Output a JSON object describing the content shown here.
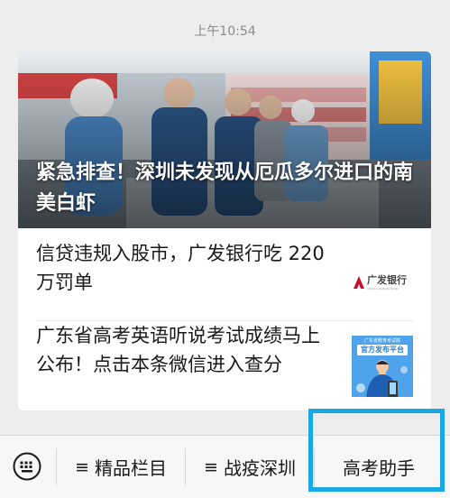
{
  "chat": {
    "timestamp": "上午10:54"
  },
  "article_card": {
    "headline": {
      "title": "紧急排查！深圳未发现从厄瓜多尔进口的南美白虾"
    },
    "items": [
      {
        "title": "信贷违规入股市，广发银行吃 220 万罚单",
        "thumb": {
          "logo_text": "广发银行",
          "logo_subtext": "CHINA GUANGFA BANK",
          "brand_color": "#c8102e"
        }
      },
      {
        "title": "广东省高考英语听说考试成绩马上公布！点击本条微信进入查分",
        "thumb": {
          "top_text": "广东省教育考试院",
          "banner_text": "官方发布平台",
          "bg_color": "#4fa3ea"
        }
      }
    ]
  },
  "bottom_menu": {
    "keyboard_icon": "keyboard-icon",
    "menu_icon": "≡",
    "items": [
      {
        "label": "精品栏目"
      },
      {
        "label": "战疫深圳"
      },
      {
        "label": "高考助手"
      }
    ],
    "highlight_color": "#1aa7e6"
  }
}
